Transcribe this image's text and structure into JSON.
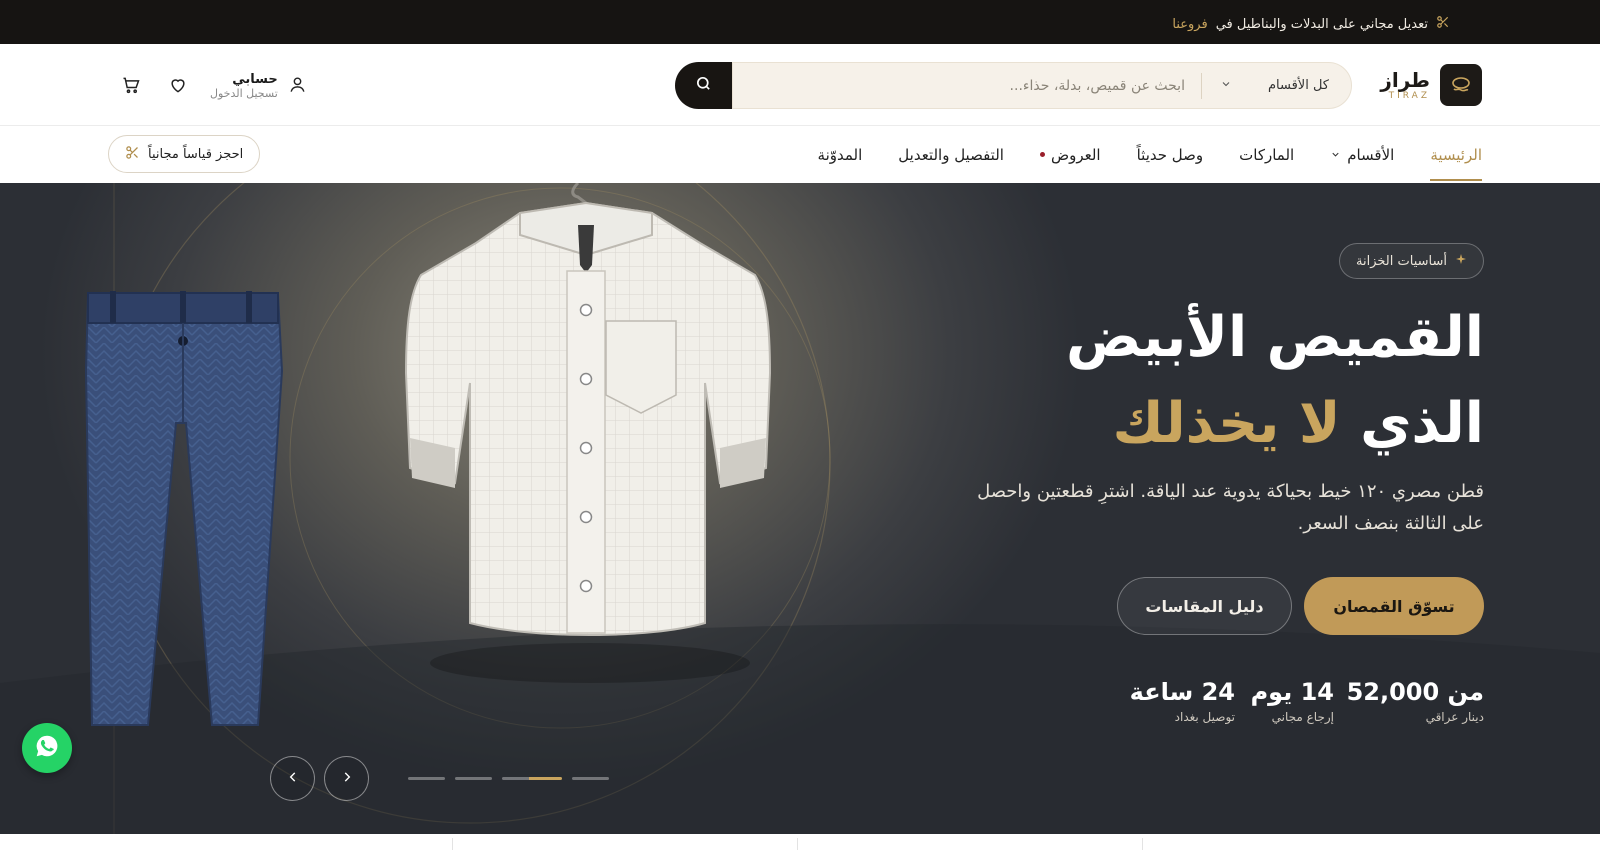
{
  "announcement": {
    "text": "تعديل مجاني على البدلات والبناطيل في",
    "highlight": "فروعنا",
    "icon": "scissors-icon"
  },
  "header": {
    "logo": {
      "name": "طراز",
      "sub": "TIRAZ"
    },
    "search": {
      "category": "كل الأقسام",
      "placeholder": "ابحث عن قميص، بدلة، حذاء..."
    },
    "account": {
      "title": "حسابي",
      "subtitle": "تسجيل الدخول"
    }
  },
  "nav": {
    "items": [
      {
        "label": "الرئيسية"
      },
      {
        "label": "الأقسام"
      },
      {
        "label": "الماركات"
      },
      {
        "label": "وصل حديثاً"
      },
      {
        "label": "العروض"
      },
      {
        "label": "التفصيل والتعديل"
      },
      {
        "label": "المدوّنة"
      }
    ],
    "book_label": "احجز قياساً مجانياً"
  },
  "hero": {
    "badge": "أساسيات الخزانة",
    "title_line1": "القميص الأبيض",
    "title_line2_white": "الذي",
    "title_line2_gold": "لا يخذلك",
    "description": "قطن مصري ١٢٠ خيط بحياكة يدوية عند الياقة. اشترِ قطعتين واحصل على الثالثة بنصف السعر.",
    "primary_button": "تسوّق القمصان",
    "secondary_button": "دليل المقاسات",
    "stats": [
      {
        "value": "من 52,000",
        "label": "دينار عراقي"
      },
      {
        "value": "14 يوم",
        "label": "إرجاع مجاني"
      },
      {
        "value": "24 ساعة",
        "label": "توصيل بغداد"
      }
    ],
    "slides_total": 4,
    "slide_active": 3
  },
  "colors": {
    "gold": "#c19a58",
    "dark": "#161412",
    "whatsapp": "#25d366"
  }
}
